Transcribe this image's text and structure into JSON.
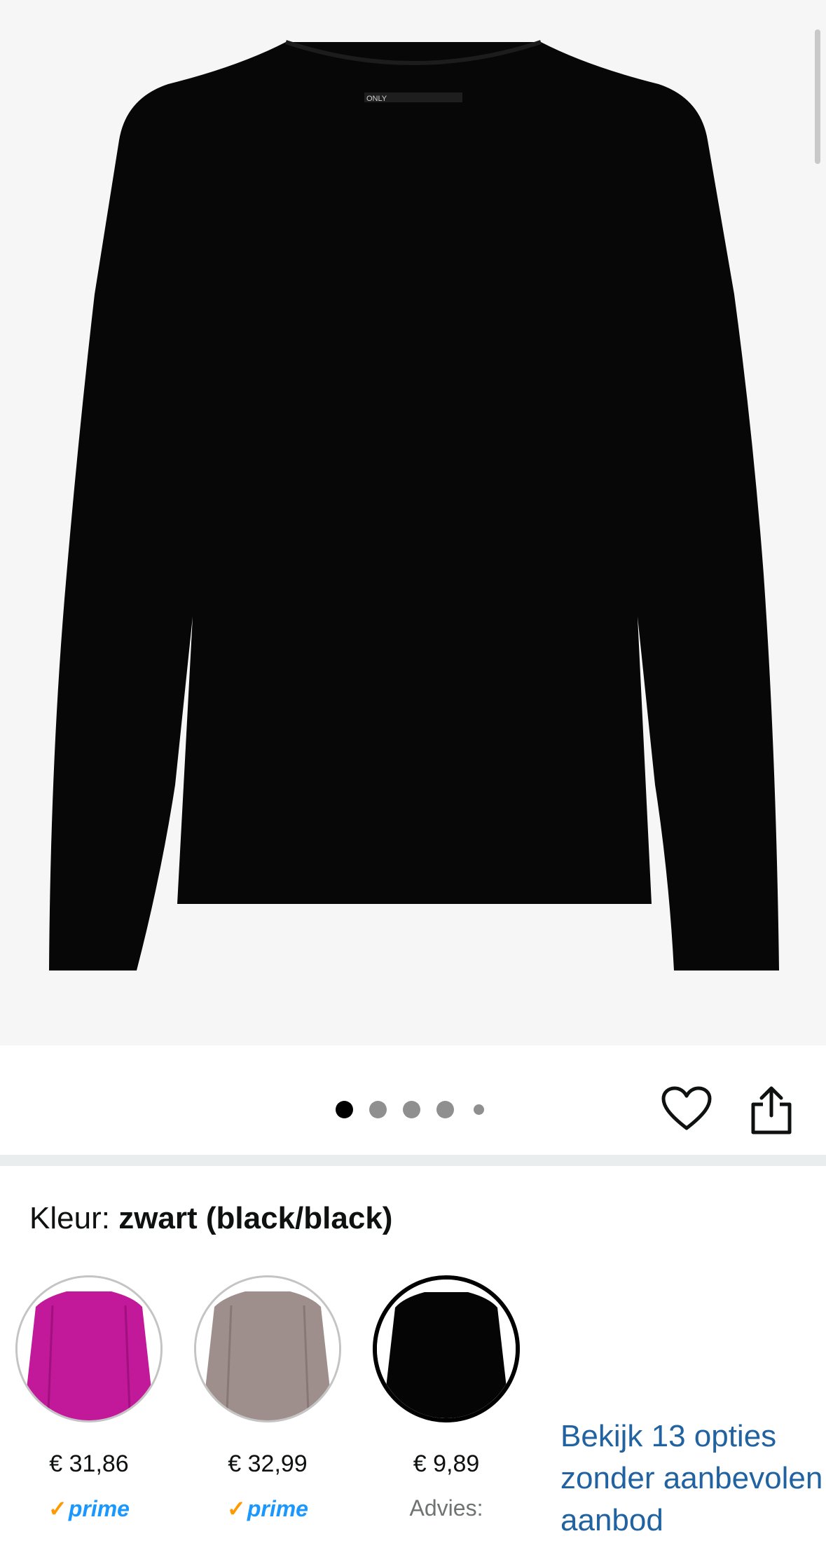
{
  "product_image": {
    "alt_icon": "sweater-image",
    "brand_tag": "ONLY",
    "carousel_dots": 5,
    "active_index": 0
  },
  "actions": {
    "heart_icon": "heart-icon",
    "share_icon": "share-icon"
  },
  "color": {
    "label": "Kleur:",
    "value": "zwart (black/black)"
  },
  "swatches": [
    {
      "name": "magenta",
      "price": "€ 31,86",
      "badge": "prime",
      "badge_type": "prime",
      "color": "#c2189a"
    },
    {
      "name": "beige",
      "price": "€ 32,99",
      "badge": "prime",
      "badge_type": "prime",
      "color": "#9e8f8c"
    },
    {
      "name": "black",
      "price": "€ 9,89",
      "badge": "Advies:",
      "badge_type": "text",
      "color": "#000000",
      "selected": true
    }
  ],
  "more_options": {
    "line1": "Bekijk 13 opties",
    "line2": "zonder aanbevolen",
    "line3": "aanbod"
  },
  "colors": {
    "link": "#2162a1",
    "prime": "#1a98ff",
    "prime_check": "#ff9900"
  }
}
